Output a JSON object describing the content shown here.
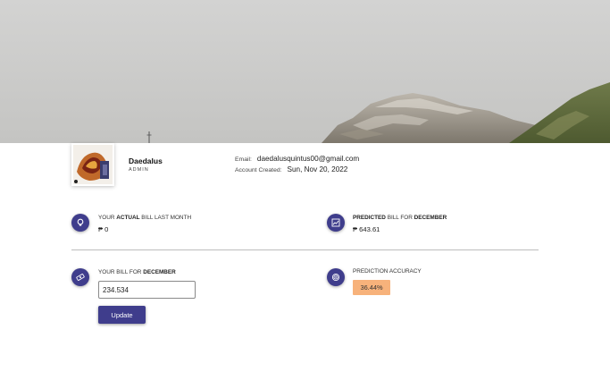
{
  "colors": {
    "accent": "#3f3d8c",
    "badge": "#f7b27b",
    "divider": "#bdbdbd"
  },
  "profile": {
    "name": "Daedalus",
    "role": "ADMIN",
    "email_label": "Email:",
    "email": "daedalusquintus00@gmail.com",
    "created_label": "Account Created:",
    "created": "Sun, Nov 20, 2022"
  },
  "stats": {
    "actual": {
      "icon": "lightbulb-icon",
      "label_pre": "YOUR ",
      "label_bold": "ACTUAL",
      "label_post": " BILL LAST MONTH",
      "value": "₱ 0"
    },
    "predicted": {
      "icon": "chart-icon",
      "label_bold": "PREDICTED",
      "label_mid": " BILL FOR ",
      "label_month": "DECEMBER",
      "value": "₱ 643.61"
    },
    "bill_input": {
      "icon": "money-icon",
      "label_pre": "YOUR BILL FOR ",
      "label_month": "DECEMBER",
      "value": "234.534",
      "button_label": "Update"
    },
    "accuracy": {
      "icon": "target-icon",
      "label": "PREDICTION ACCURACY",
      "value": "36.44%"
    }
  }
}
